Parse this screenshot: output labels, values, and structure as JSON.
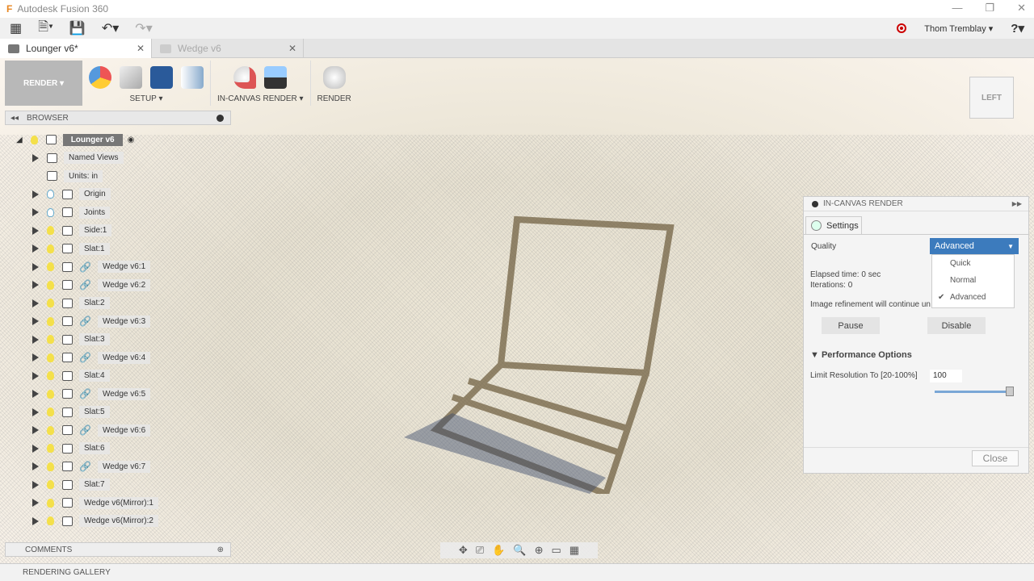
{
  "app": {
    "title": "Autodesk Fusion 360",
    "logo": "F"
  },
  "qat": {
    "user": "Thom Tremblay",
    "help": "?"
  },
  "tabs": [
    {
      "label": "Lounger v6*",
      "active": true
    },
    {
      "label": "Wedge v6",
      "active": false
    }
  ],
  "toolbar": {
    "workspace": "RENDER ▾",
    "setup": "SETUP ▾",
    "in_canvas": "IN-CANVAS RENDER ▾",
    "render": "RENDER"
  },
  "browser": {
    "title": "BROWSER",
    "root": "Lounger v6",
    "items": [
      "Named Views",
      "Units: in",
      "Origin",
      "Joints",
      "Side:1",
      "Slat:1",
      "Wedge v6:1",
      "Wedge v6:2",
      "Slat:2",
      "Wedge v6:3",
      "Slat:3",
      "Wedge v6:4",
      "Slat:4",
      "Wedge v6:5",
      "Slat:5",
      "Wedge v6:6",
      "Slat:6",
      "Wedge v6:7",
      "Slat:7",
      "Wedge v6(Mirror):1",
      "Wedge v6(Mirror):2"
    ]
  },
  "comments": "COMMENTS",
  "gallery": "RENDERING GALLERY",
  "viewcube": "LEFT",
  "panel": {
    "title": "IN-CANVAS RENDER",
    "tab": "Settings",
    "quality_label": "Quality",
    "quality_value": "Advanced",
    "options": [
      "Quick",
      "Normal",
      "Advanced"
    ],
    "selected": "Advanced",
    "elapsed": "Elapsed time: 0 sec",
    "iterations": "Iterations: 0",
    "refine": "Image refinement will continue un",
    "pause": "Pause",
    "disable": "Disable",
    "perf": "Performance Options",
    "limit_label": "Limit Resolution To [20-100%]",
    "limit_value": "100",
    "limit_percent": 100,
    "close": "Close"
  },
  "colors": {
    "accent": "#3c7bbd"
  }
}
